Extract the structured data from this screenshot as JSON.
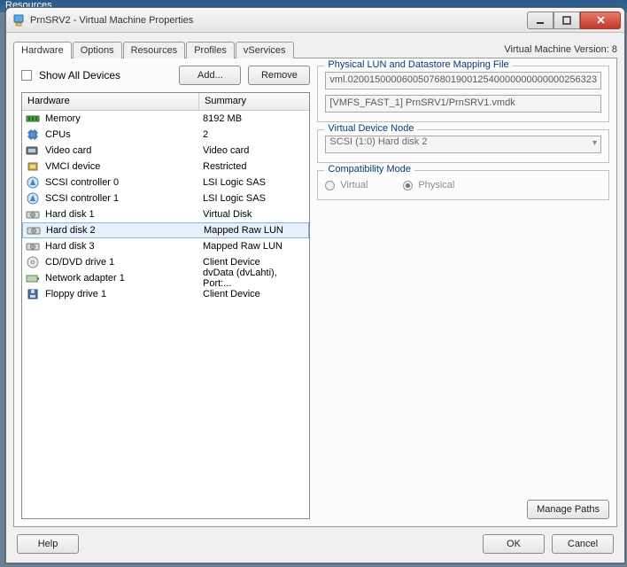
{
  "bg_title": "Resources",
  "window": {
    "title": "PrnSRV2 - Virtual Machine Properties",
    "version": "Virtual Machine Version: 8"
  },
  "tabs": [
    "Hardware",
    "Options",
    "Resources",
    "Profiles",
    "vServices"
  ],
  "active_tab": 0,
  "toolbar": {
    "show_all_devices": "Show All Devices",
    "add": "Add...",
    "remove": "Remove"
  },
  "columns": {
    "hardware": "Hardware",
    "summary": "Summary"
  },
  "rows": [
    {
      "icon": "memory",
      "name": "Memory",
      "summary": "8192 MB"
    },
    {
      "icon": "cpu",
      "name": "CPUs",
      "summary": "2"
    },
    {
      "icon": "video",
      "name": "Video card",
      "summary": "Video card"
    },
    {
      "icon": "vmci",
      "name": "VMCI device",
      "summary": "Restricted"
    },
    {
      "icon": "scsi",
      "name": "SCSI controller 0",
      "summary": "LSI Logic SAS"
    },
    {
      "icon": "scsi",
      "name": "SCSI controller 1",
      "summary": "LSI Logic SAS"
    },
    {
      "icon": "disk",
      "name": "Hard disk 1",
      "summary": "Virtual Disk"
    },
    {
      "icon": "disk",
      "name": "Hard disk 2",
      "summary": "Mapped Raw LUN",
      "selected": true
    },
    {
      "icon": "disk",
      "name": "Hard disk 3",
      "summary": "Mapped Raw LUN"
    },
    {
      "icon": "cd",
      "name": "CD/DVD drive 1",
      "summary": "Client Device"
    },
    {
      "icon": "nic",
      "name": "Network adapter 1",
      "summary": "dvData (dvLahti), Port:..."
    },
    {
      "icon": "floppy",
      "name": "Floppy drive 1",
      "summary": "Client Device"
    }
  ],
  "lun": {
    "legend": "Physical LUN and Datastore Mapping File",
    "lun_path": "vml.0200150000600507680190012540000000000000256323",
    "ds_path": "[VMFS_FAST_1] PrnSRV1/PrnSRV1.vmdk"
  },
  "vdn": {
    "legend": "Virtual Device Node",
    "value": "SCSI (1:0) Hard disk 2"
  },
  "compat": {
    "legend": "Compatibility Mode",
    "virtual": "Virtual",
    "physical": "Physical",
    "selected": "physical"
  },
  "buttons": {
    "manage_paths": "Manage Paths",
    "help": "Help",
    "ok": "OK",
    "cancel": "Cancel"
  }
}
